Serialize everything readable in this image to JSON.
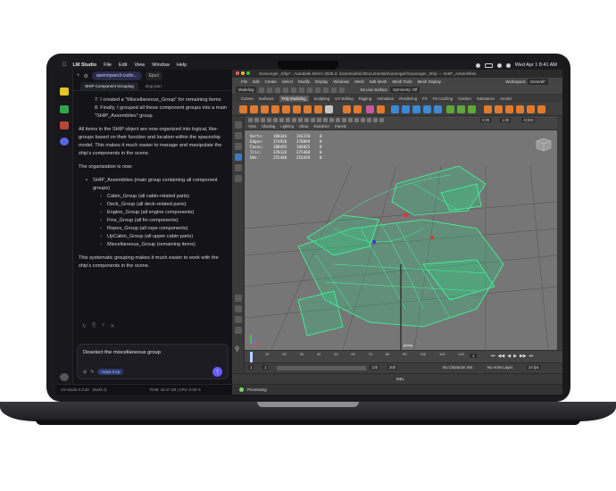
{
  "menubar": {
    "app_name": "LM Studio",
    "items": [
      "File",
      "Edit",
      "View",
      "Window",
      "Help"
    ],
    "datetime": "Wed Apr 1  8:41 AM"
  },
  "lmstudio": {
    "model_pill": "qwen/qwen3-codin...",
    "eject_label": "Eject",
    "tabs": [
      {
        "label": "SHIP Component Grouping"
      },
      {
        "label": "mcp.json"
      }
    ],
    "list_item_7": "7. I created a \"Miscellaneous_Group\" for remaining items",
    "list_item_8": "8. Finally, I grouped all these component groups into a main \"SHIP_Assemblies\" group",
    "para1": "All items in the SHIP object are now organized into logical, like-groups based on their function and location within the spaceship model. This makes it much easier to manage and manipulate the ship's components in the scene.",
    "para2": "The organization is now:",
    "top_bullet": "SHIP_Assemblies (main group containing all component groups)",
    "sub_bullets": [
      "Cabin_Group (all cabin-related parts)",
      "Deck_Group (all deck-related parts)",
      "Engine_Group (all engine components)",
      "Fins_Group (all fin components)",
      "Ropes_Group (all rope components)",
      "UpCabin_Group (all upper cabin parts)",
      "Miscellaneous_Group (remaining items)"
    ],
    "para3": "This systematic grouping makes it much easier to work with the ship's components in the scene.",
    "input_text": "Deselect the miscellaneous group",
    "mcp_chip": "maya-mcp",
    "status_app": "LM Studio 0.3.30",
    "status_build": "(Build 2)",
    "status_stats": "RAM: 18.47 GB  |  CPU: 0.00 %"
  },
  "maya": {
    "title": "Scavenger_Ship* - Autodesk MAYA 2026.3: /Users/admin/Documents/Scavenger/Scavenger_Ship  ---  SHIP_Assemblies",
    "menu": [
      "File",
      "Edit",
      "Create",
      "Select",
      "Modify",
      "Display",
      "Windows",
      "Mesh",
      "Edit Mesh",
      "Mesh Tools",
      "Mesh Display"
    ],
    "workspace_label": "Workspace:",
    "workspace_value": "General*",
    "mode_value": "Modeling",
    "live_surface": "No Live Surface",
    "symmetry": "Symmetry: Off",
    "shelf_tabs": [
      "Curves",
      "Surfaces",
      "Poly Modeling",
      "Sculpting",
      "UV Editing",
      "Rigging",
      "Animation",
      "Rendering",
      "FX",
      "FX Caching",
      "Custom",
      "Substance",
      "Arnold"
    ],
    "active_shelf": "Poly Modeling",
    "panel_menu": [
      "View",
      "Shading",
      "Lighting",
      "Show",
      "Renderer",
      "Panels"
    ],
    "field_a": "0.00",
    "field_b": "1.00",
    "color_space": "ACES",
    "hud": [
      [
        "Verts:",
        "188344",
        "193370",
        "0"
      ],
      [
        "Edges:",
        "374920",
        "378099",
        "0"
      ],
      [
        "Faces:",
        "188493",
        "184025",
        "0"
      ],
      [
        "Tris:",
        "370124",
        "375468",
        "0"
      ],
      [
        "UVs:",
        "255440",
        "255439",
        "0"
      ]
    ],
    "camera_label": "persp",
    "timeline_ticks": [
      "1",
      "10",
      "20",
      "30",
      "40",
      "50",
      "60",
      "70",
      "80",
      "90",
      "100",
      "110",
      "120"
    ],
    "current_frame": "1",
    "range_start": "1",
    "range_start2": "1",
    "range_end": "120",
    "range_end2": "200",
    "character_set": "No Character Set",
    "anim_layer": "No Anim Layer",
    "fps": "24 fps",
    "cmd_lang": "MEL",
    "help_text": "Processing"
  }
}
